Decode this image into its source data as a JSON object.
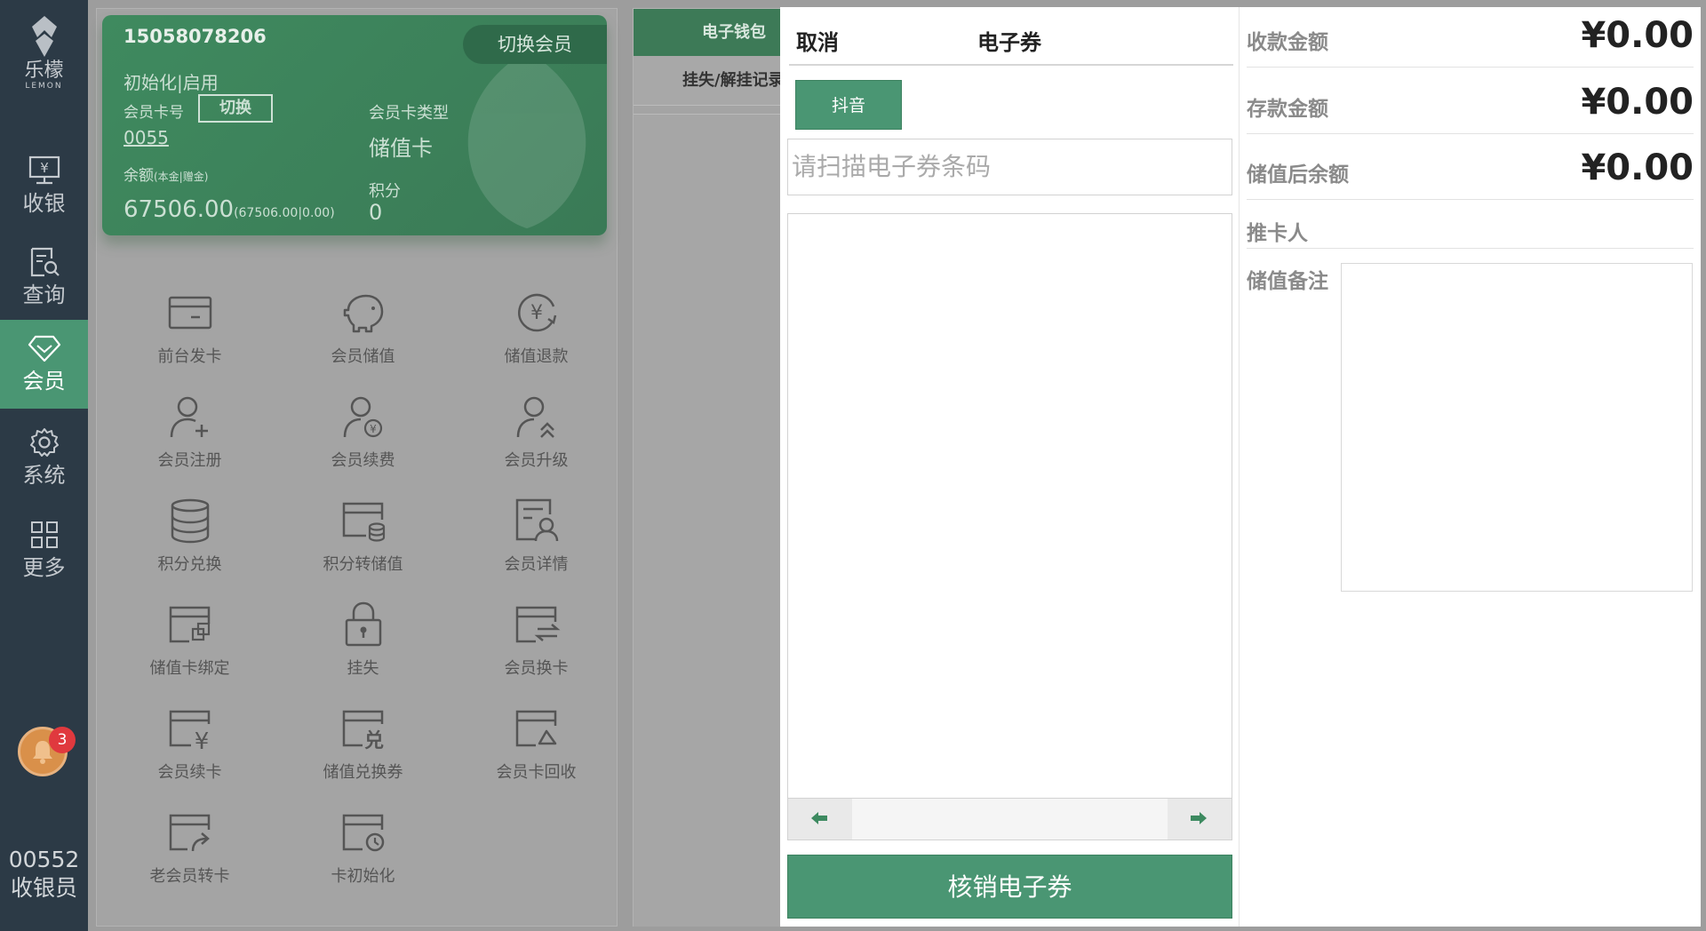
{
  "sidebar": {
    "logo_cn": "乐檬",
    "logo_en": "LEMON",
    "items": [
      {
        "label": "收银",
        "icon": "cash-register-icon"
      },
      {
        "label": "查询",
        "icon": "search-document-icon"
      },
      {
        "label": "会员",
        "icon": "diamond-icon"
      },
      {
        "label": "系统",
        "icon": "gear-icon"
      },
      {
        "label": "更多",
        "icon": "grid-icon"
      }
    ],
    "notification_count": "3",
    "cashier_id": "00552",
    "cashier_role": "收银员"
  },
  "member_card": {
    "phone": "15058078206",
    "switch_member": "切换会员",
    "status": "初始化|启用",
    "card_no_label": "会员卡号",
    "card_no_switch": "切换",
    "card_no": "0055",
    "balance_label": "余额",
    "balance_label_detail": "(本金|赠金)",
    "balance": "67506.00",
    "balance_detail": "(67506.00|0.00)",
    "card_type_label": "会员卡类型",
    "card_type": "储值卡",
    "points_label": "积分",
    "points": "0"
  },
  "functions": [
    {
      "label": "前台发卡",
      "icon": "card-icon"
    },
    {
      "label": "会员储值",
      "icon": "piggy-bank-icon"
    },
    {
      "label": "储值退款",
      "icon": "yen-refund-icon"
    },
    {
      "label": "会员注册",
      "icon": "user-add-icon"
    },
    {
      "label": "会员续费",
      "icon": "user-yen-icon"
    },
    {
      "label": "会员升级",
      "icon": "user-upgrade-icon"
    },
    {
      "label": "积分兑换",
      "icon": "database-icon"
    },
    {
      "label": "积分转储值",
      "icon": "card-coins-icon"
    },
    {
      "label": "会员详情",
      "icon": "member-detail-icon"
    },
    {
      "label": "储值卡绑定",
      "icon": "card-bind-icon"
    },
    {
      "label": "挂失",
      "icon": "lock-icon"
    },
    {
      "label": "会员换卡",
      "icon": "card-swap-icon"
    },
    {
      "label": "会员续卡",
      "icon": "card-yen-icon"
    },
    {
      "label": "储值兑换券",
      "icon": "card-coupon-icon"
    },
    {
      "label": "会员卡回收",
      "icon": "card-recycle-icon"
    },
    {
      "label": "老会员转卡",
      "icon": "card-transfer-icon"
    },
    {
      "label": "卡初始化",
      "icon": "card-reset-icon"
    }
  ],
  "middle": {
    "tab_wallet": "电子钱包",
    "tab_loss": "挂失/解挂记录"
  },
  "dialog": {
    "cancel": "取消",
    "title": "电子券",
    "douyin_button": "抖音",
    "scan_placeholder": "请扫描电子券条码",
    "verify_button": "核销电子券",
    "amount_received_label": "收款金额",
    "amount_received": "¥0.00",
    "deposit_amount_label": "存款金额",
    "deposit_amount": "¥0.00",
    "balance_after_label": "储值后余额",
    "balance_after": "¥0.00",
    "referrer_label": "推卡人",
    "remark_label": "储值备注"
  }
}
